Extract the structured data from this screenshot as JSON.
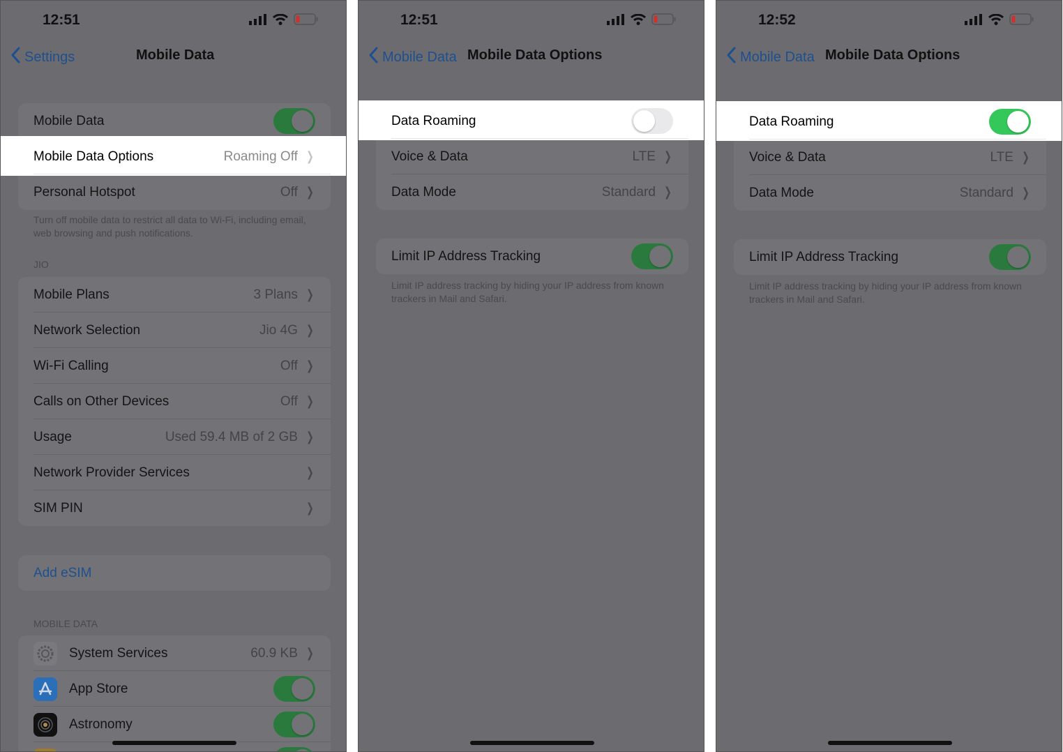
{
  "colors": {
    "accent": "#1e4f8e",
    "toggle_on": "#34c759",
    "toggle_on_dimmed": "#2a7a3e",
    "highlight": "#ffffff"
  },
  "panels": [
    {
      "time": "12:51",
      "back_label": "Settings",
      "title": "Mobile Data",
      "sections": [
        {
          "rows": [
            {
              "label": "Mobile Data",
              "toggle": "on"
            },
            {
              "label": "Mobile Data Options",
              "value": "Roaming Off",
              "chevron": true,
              "highlighted": true
            },
            {
              "label": "Personal Hotspot",
              "value": "Off",
              "chevron": true
            }
          ],
          "footer": "Turn off mobile data to restrict all data to Wi-Fi, including email, web browsing and push notifications."
        },
        {
          "header": "JIO",
          "rows": [
            {
              "label": "Mobile Plans",
              "value": "3 Plans",
              "chevron": true
            },
            {
              "label": "Network Selection",
              "value": "Jio 4G",
              "chevron": true
            },
            {
              "label": "Wi-Fi Calling",
              "value": "Off",
              "chevron": true
            },
            {
              "label": "Calls on Other Devices",
              "value": "Off",
              "chevron": true
            },
            {
              "label": "Usage",
              "value": "Used 59.4 MB of 2 GB",
              "chevron": true
            },
            {
              "label": "Network Provider Services",
              "chevron": true
            },
            {
              "label": "SIM PIN",
              "chevron": true
            }
          ]
        },
        {
          "rows": [
            {
              "label": "Add eSIM",
              "link": true
            }
          ]
        },
        {
          "header": "MOBILE DATA",
          "rows": [
            {
              "label": "System Services",
              "value": "60.9 KB",
              "chevron": true,
              "icon": "settings-gear-icon"
            },
            {
              "label": "App Store",
              "toggle": "on",
              "icon": "app-store-icon"
            },
            {
              "label": "Astronomy",
              "toggle": "on",
              "icon": "astronomy-icon"
            },
            {
              "label": "",
              "toggle": "on",
              "icon": "app-icon"
            }
          ]
        }
      ]
    },
    {
      "time": "12:51",
      "back_label": "Mobile Data",
      "title": "Mobile Data Options",
      "sections": [
        {
          "rows": [
            {
              "label": "Data Roaming",
              "toggle": "off",
              "highlighted": true
            },
            {
              "label": "Voice & Data",
              "value": "LTE",
              "chevron": true
            },
            {
              "label": "Data Mode",
              "value": "Standard",
              "chevron": true
            }
          ]
        },
        {
          "rows": [
            {
              "label": "Limit IP Address Tracking",
              "toggle": "on"
            }
          ],
          "footer": "Limit IP address tracking by hiding your IP address from known trackers in Mail and Safari."
        }
      ]
    },
    {
      "time": "12:52",
      "back_label": "Mobile Data",
      "title": "Mobile Data Options",
      "sections": [
        {
          "rows": [
            {
              "label": "Data Roaming",
              "toggle": "on",
              "highlighted": true
            },
            {
              "label": "Voice & Data",
              "value": "LTE",
              "chevron": true
            },
            {
              "label": "Data Mode",
              "value": "Standard",
              "chevron": true
            }
          ]
        },
        {
          "rows": [
            {
              "label": "Limit IP Address Tracking",
              "toggle": "on"
            }
          ],
          "footer": "Limit IP address tracking by hiding your IP address from known trackers in Mail and Safari."
        }
      ]
    }
  ]
}
